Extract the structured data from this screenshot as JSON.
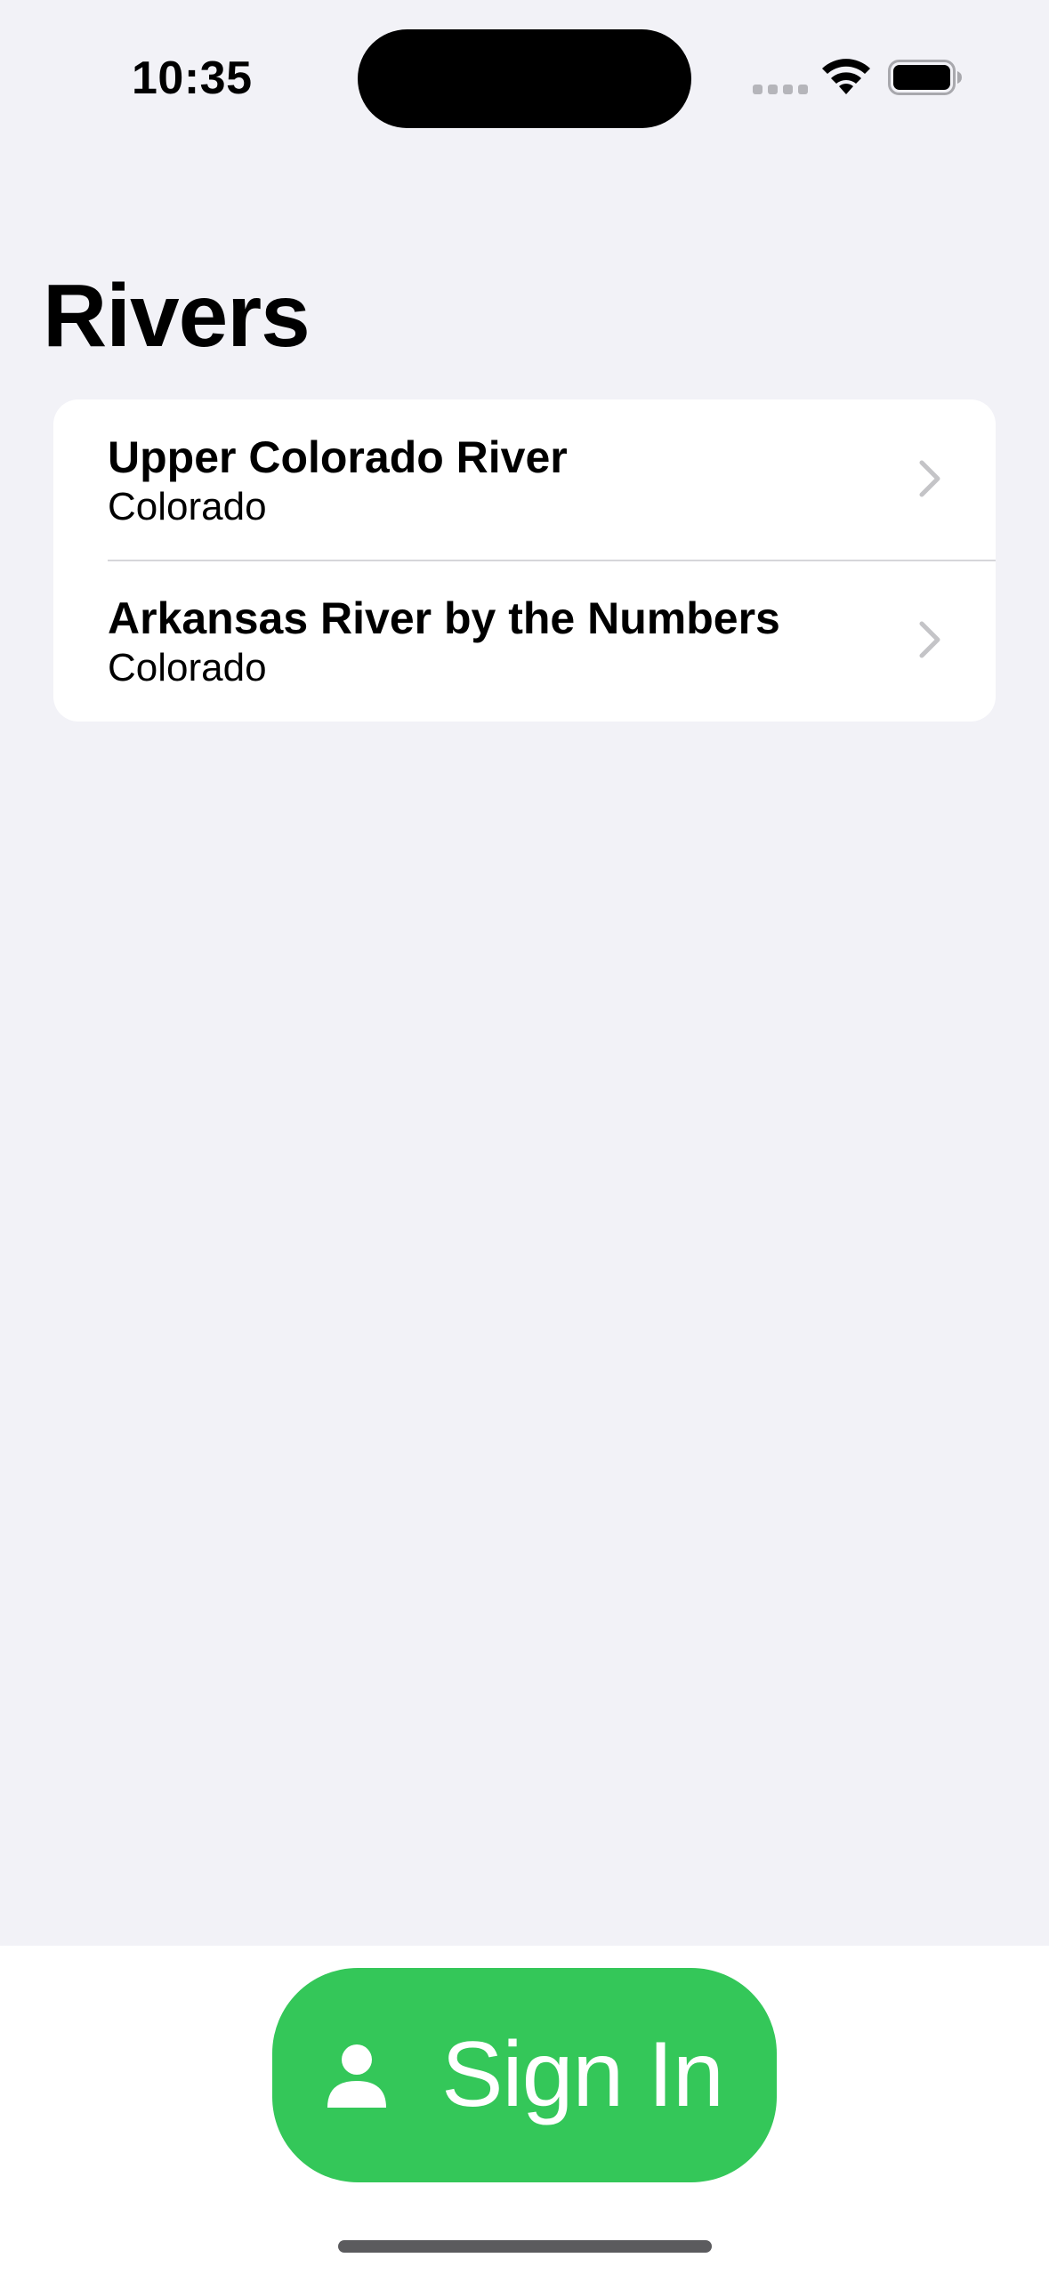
{
  "status_bar": {
    "time": "10:35",
    "icons": [
      "signal-dots-icon",
      "wifi-icon",
      "battery-icon"
    ]
  },
  "page": {
    "title": "Rivers"
  },
  "rivers": [
    {
      "title": "Upper Colorado River",
      "subtitle": "Colorado",
      "icon": "chevron-right-icon"
    },
    {
      "title": "Arkansas River by the Numbers",
      "subtitle": "Colorado",
      "icon": "chevron-right-icon"
    }
  ],
  "bottom_bar": {
    "signin_label": "Sign In",
    "signin_icon": "person-icon"
  },
  "colors": {
    "background": "#f2f2f7",
    "card": "#ffffff",
    "accent_green": "#34c759",
    "chevron": "#c4c4c7"
  }
}
